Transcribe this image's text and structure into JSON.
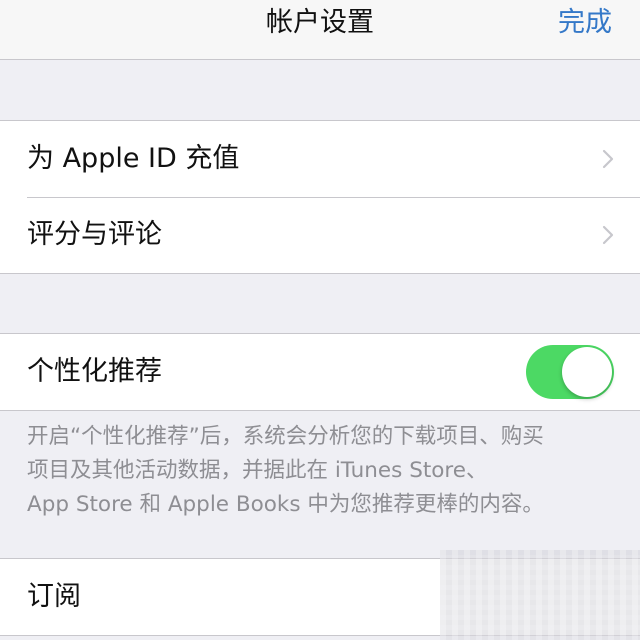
{
  "navbar": {
    "title": "帐户设置",
    "done_label": "完成"
  },
  "accent_color": "#3478c8",
  "toggle_on_color": "#4cd964",
  "group1": {
    "items": [
      {
        "label": "为 Apple ID 充值",
        "icon": "chevron-right-icon"
      },
      {
        "label": "评分与评论",
        "icon": "chevron-right-icon"
      }
    ]
  },
  "group2": {
    "label": "个性化推荐",
    "toggle_on": true
  },
  "group2_footer": "开启“个性化推荐”后，系统会分析您的下载项目、购买\n项目及其他活动数据，并据此在 iTunes Store、\nApp Store 和 Apple Books 中为您推荐更棒的内容。",
  "group3": {
    "items": [
      {
        "label": "订阅"
      }
    ]
  }
}
